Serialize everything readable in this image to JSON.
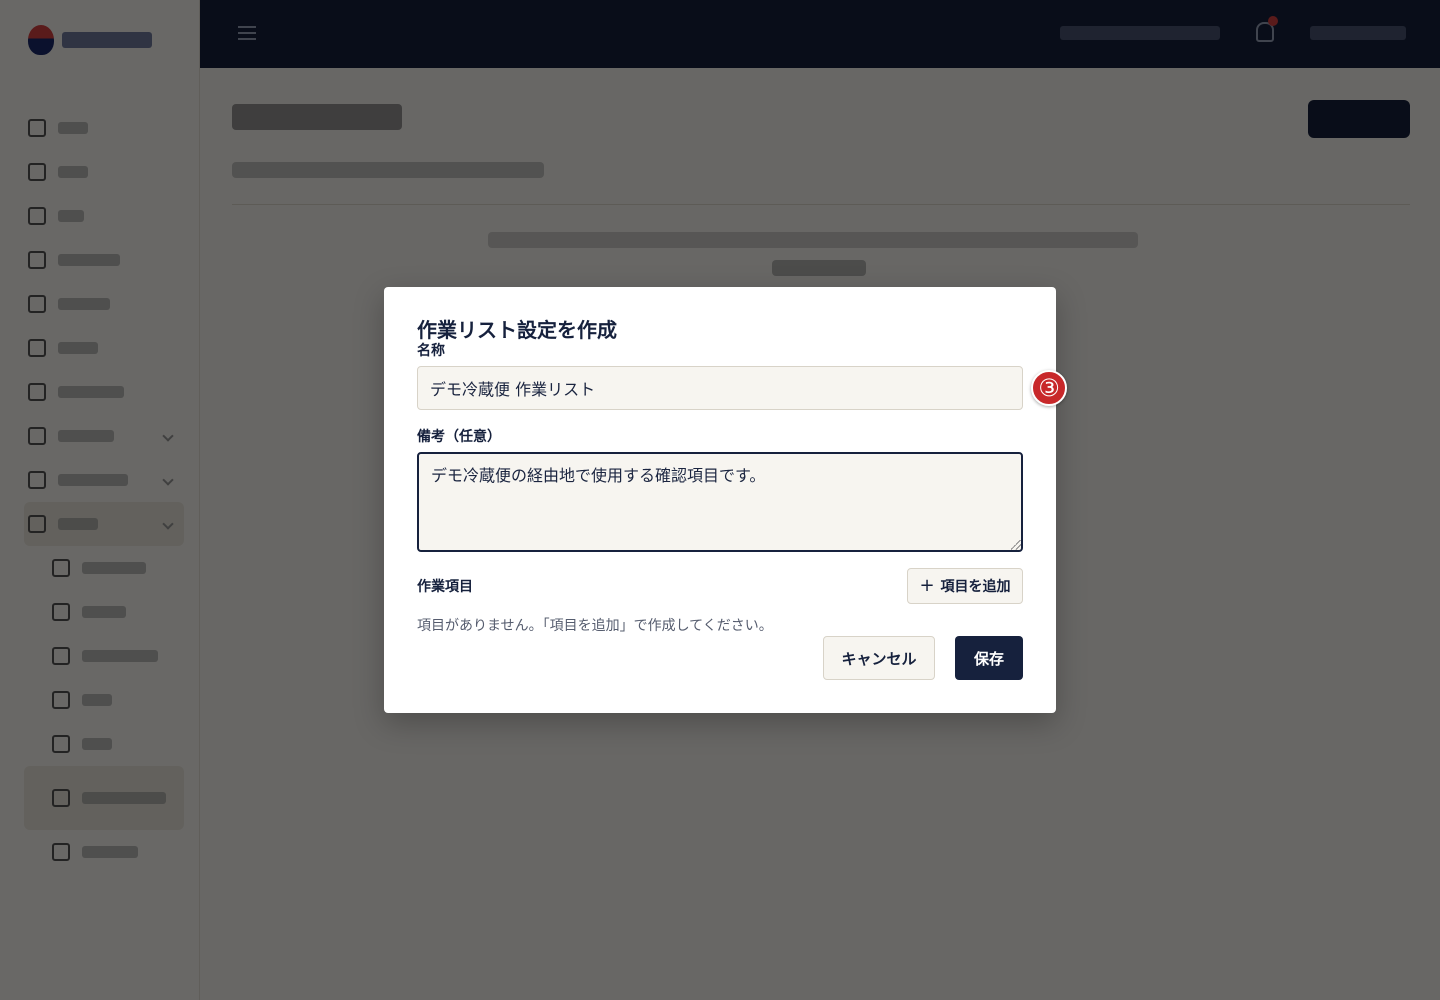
{
  "dialog": {
    "title": "作業リスト設定を作成",
    "name_label": "名称",
    "name_value": "デモ冷蔵便 作業リスト",
    "note_label": "備考（任意）",
    "note_value": "デモ冷蔵便の経由地で使用する確認項目です。",
    "items_label": "作業項目",
    "add_item_label": "項目を追加",
    "empty_message": "項目がありません。「項目を追加」で作成してください。",
    "cancel_label": "キャンセル",
    "save_label": "保存"
  },
  "annotation": {
    "step_badge": "③"
  },
  "colors": {
    "primary": "#16213d",
    "badge": "#c8282a",
    "input_bg": "#f7f5f0"
  },
  "icons": {
    "add": "plus-icon",
    "menu": "menu-icon",
    "notifications": "bell-icon"
  }
}
